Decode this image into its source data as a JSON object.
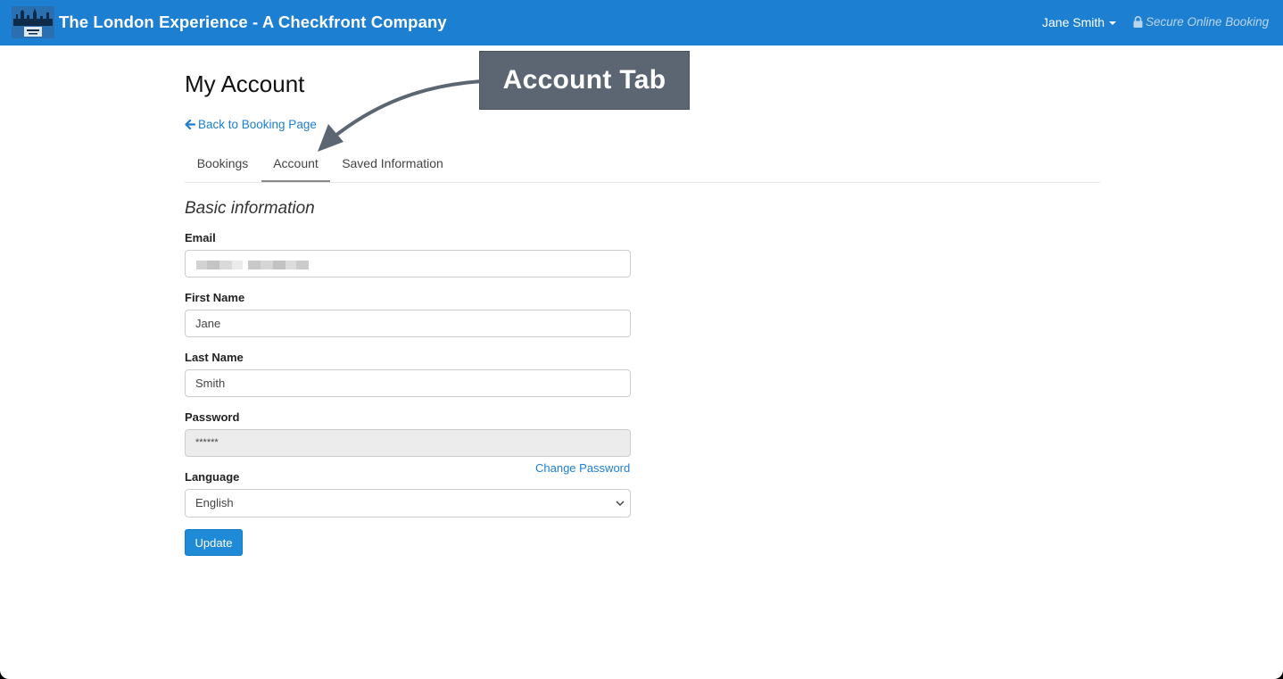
{
  "header": {
    "brand": "The London Experience - A Checkfront Company",
    "logo_icon": "london-skyline-logo",
    "user_name": "Jane Smith",
    "secure_text": "Secure Online Booking",
    "accent_color": "#1d7fd1"
  },
  "page": {
    "title": "My Account",
    "back_link": "Back to Booking Page"
  },
  "tabs": [
    {
      "label": "Bookings",
      "active": false
    },
    {
      "label": "Account",
      "active": true
    },
    {
      "label": "Saved Information",
      "active": false
    }
  ],
  "form": {
    "section_title": "Basic information",
    "email_label": "Email",
    "email_value": "",
    "first_name_label": "First Name",
    "first_name_value": "Jane",
    "last_name_label": "Last Name",
    "last_name_value": "Smith",
    "password_label": "Password",
    "password_value": "******",
    "change_password": "Change Password",
    "language_label": "Language",
    "language_value": "English",
    "update_button": "Update"
  },
  "annotation": {
    "callout_text": "Account Tab"
  }
}
